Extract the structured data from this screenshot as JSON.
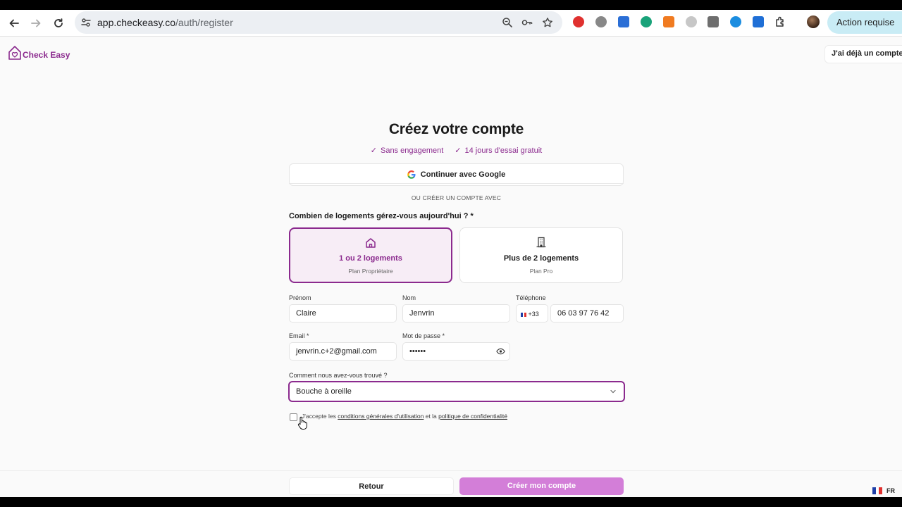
{
  "browser": {
    "url_host": "app.checkeasy.co",
    "url_path": "/auth/register",
    "profile_button": "Action requise",
    "extensions": [
      {
        "name": "opera-extension-icon",
        "color": "#e0312f"
      },
      {
        "name": "circle-extension-icon",
        "color": "#888888"
      },
      {
        "name": "e-extension-icon",
        "color": "#2b6fd6"
      },
      {
        "name": "green-extension-icon",
        "color": "#1aa37a"
      },
      {
        "name": "orange-extension-icon",
        "color": "#f07b21"
      },
      {
        "name": "shape-extension-icon",
        "color": "#c7c7c7"
      },
      {
        "name": "grid-extension-icon",
        "color": "#6e6e6e"
      },
      {
        "name": "shazam-extension-icon",
        "color": "#1c8de0"
      },
      {
        "name": "gear-extension-icon",
        "color": "#1f6fd6"
      }
    ]
  },
  "header": {
    "logo_text": "Check Easy",
    "already_account": "J'ai déjà un compte !"
  },
  "form": {
    "title": "Créez votre compte",
    "perks": [
      "Sans engagement",
      "14 jours d'essai gratuit"
    ],
    "google_button": "Continuer avec Google",
    "or_text": "OU CRÉER UN COMPTE AVEC",
    "question": "Combien de logements gérez-vous aujourd'hui ? *",
    "plans": [
      {
        "name": "1 ou 2 logements",
        "sub": "Plan Propriétaire",
        "selected": true
      },
      {
        "name": "Plus de 2 logements",
        "sub": "Plan Pro",
        "selected": false
      }
    ],
    "fields": {
      "firstname_label": "Prénom",
      "firstname_value": "Claire",
      "lastname_label": "Nom",
      "lastname_value": "Jenvrin",
      "phone_label": "Téléphone",
      "phone_prefix": "+33",
      "phone_value": "06 03 97 76 42",
      "email_label": "Email *",
      "email_value": "jenvrin.c+2@gmail.com",
      "password_label": "Mot de passe *",
      "password_value": "••••••",
      "source_label": "Comment nous avez-vous trouvé ?",
      "source_value": "Bouche à oreille"
    },
    "terms": {
      "prefix": "J'accepte les ",
      "cgu": "conditions générales d'utilisation",
      "middle": " et la ",
      "privacy": "politique de confidentialité",
      "checked": false
    },
    "back_button": "Retour",
    "create_button": "Créer mon compte"
  },
  "lang": "FR",
  "colors": {
    "accent": "#8b2a8e",
    "accent_light": "#f7edf6",
    "create_button": "#d37ed8"
  }
}
